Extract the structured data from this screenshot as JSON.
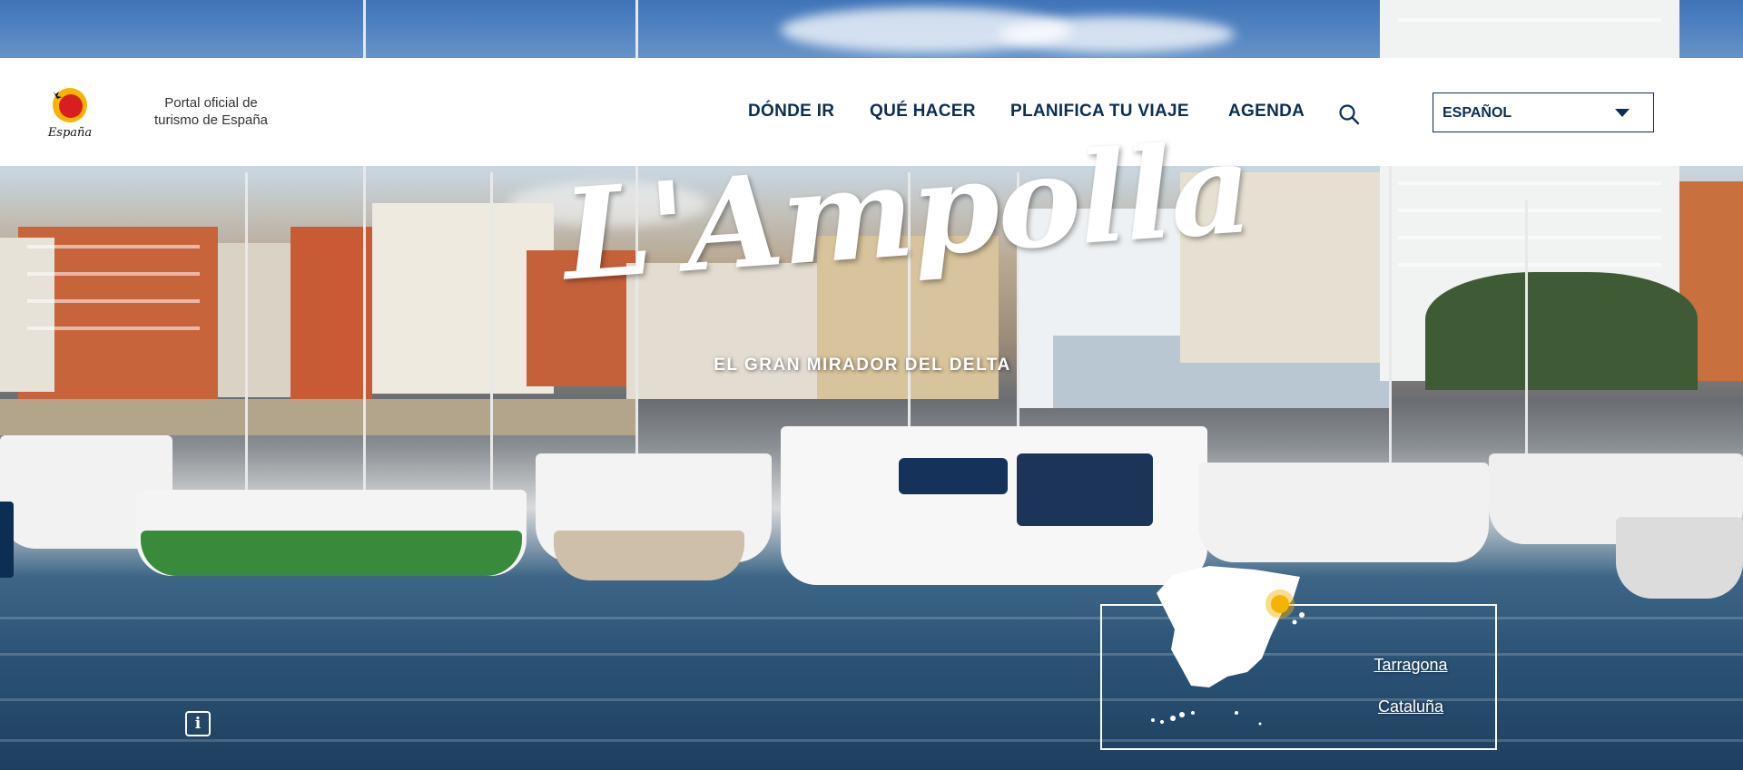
{
  "header": {
    "logo_text": "España",
    "tagline": "Portal oficial de turismo de España"
  },
  "nav": {
    "items": [
      {
        "label": "DÓNDE IR"
      },
      {
        "label": "QUÉ HACER"
      },
      {
        "label": "PLANIFICA TU VIAJE"
      },
      {
        "label": "AGENDA"
      }
    ],
    "search_icon": "search-icon"
  },
  "language": {
    "selected": "ESPAÑOL",
    "icon": "chevron-down-icon"
  },
  "hero": {
    "title": "L'Ampolla",
    "subtitle": "EL GRAN MIRADOR DEL DELTA"
  },
  "location": {
    "province": "Tarragona",
    "region": "Cataluña",
    "map_icon": "spain-map-icon"
  },
  "info_icon": "info-icon",
  "colors": {
    "navy": "#0b2e52",
    "marker": "#f4b400",
    "white": "#ffffff"
  }
}
